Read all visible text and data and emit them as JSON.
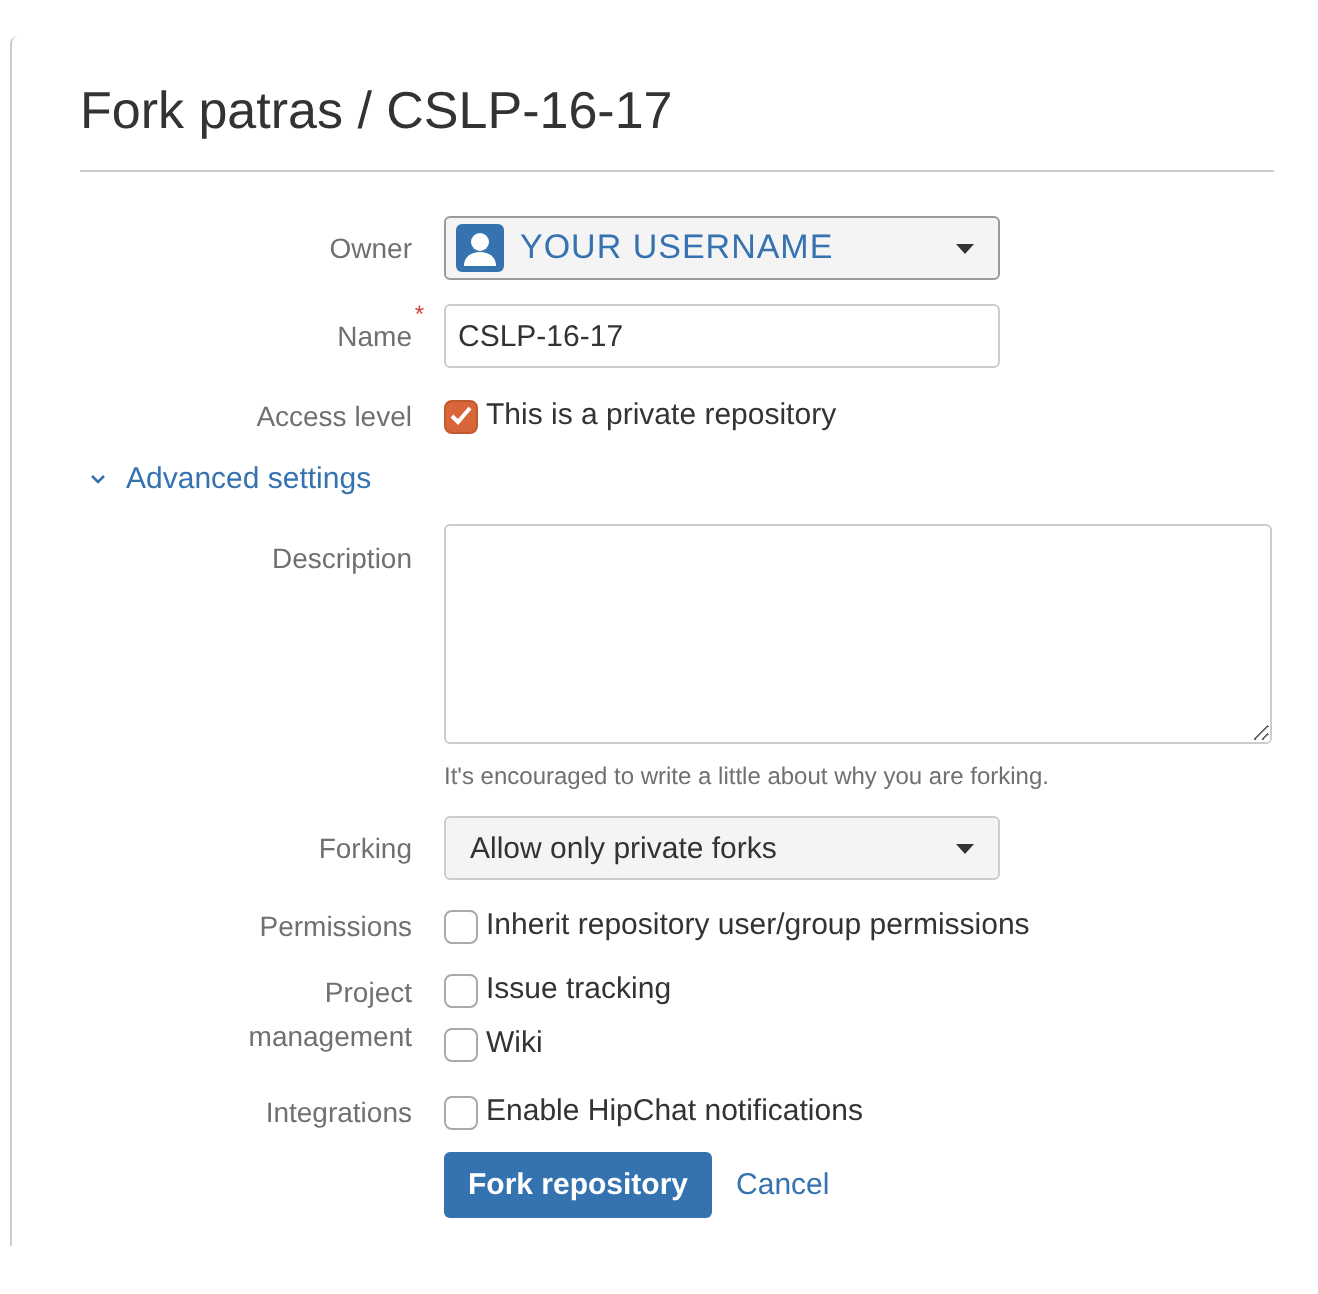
{
  "title": "Fork patras / CSLP-16-17",
  "owner": {
    "label": "Owner",
    "value": "YOUR USERNAME"
  },
  "name": {
    "label": "Name",
    "required_mark": "*",
    "value": "CSLP-16-17"
  },
  "access": {
    "label": "Access level",
    "options": [
      {
        "label": "This is a private repository",
        "checked": true
      }
    ]
  },
  "advanced": {
    "label": "Advanced settings",
    "expanded": true
  },
  "description": {
    "label": "Description",
    "help": "It's encouraged to write a little about why you are forking."
  },
  "forking": {
    "label": "Forking",
    "value": "Allow only private forks"
  },
  "permissions": {
    "label": "Permissions",
    "options": [
      {
        "label": "Inherit repository user/group permissions",
        "checked": false
      }
    ]
  },
  "project_management": {
    "label": "Project management",
    "options": [
      {
        "label": "Issue tracking",
        "checked": false
      },
      {
        "label": "Wiki",
        "checked": false
      }
    ]
  },
  "integrations": {
    "label": "Integrations",
    "options": [
      {
        "label": "Enable HipChat notifications",
        "checked": false
      }
    ]
  },
  "buttons": [
    {
      "label": "Fork repository",
      "kind": "primary"
    },
    {
      "label": "Cancel",
      "kind": "link"
    }
  ]
}
